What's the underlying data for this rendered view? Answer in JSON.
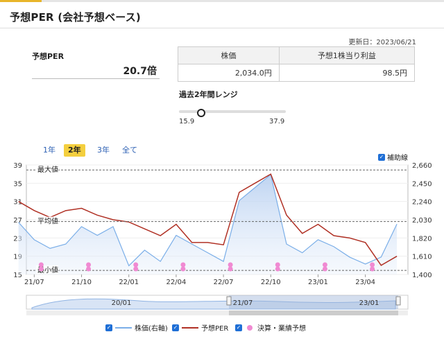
{
  "header": {
    "title": "予想PER (会社予想ベース)"
  },
  "updated": "更新日：2023/06/21",
  "per": {
    "label": "予想PER",
    "value": "20.7倍"
  },
  "stock_table": {
    "headers": [
      "株価",
      "予想1株当り利益"
    ],
    "values": [
      "2,034.0円",
      "98.5円"
    ]
  },
  "range": {
    "label": "過去2年間レンジ",
    "min": "15.9",
    "max": "37.9",
    "current": 20.7
  },
  "period_tabs": [
    {
      "label": "1年",
      "active": false
    },
    {
      "label": "2年",
      "active": true
    },
    {
      "label": "3年",
      "active": false
    },
    {
      "label": "全て",
      "active": false
    }
  ],
  "aux_line": {
    "label": "補助線",
    "checked": true
  },
  "chart_data": {
    "type": "line",
    "left_axis_ticks": [
      "39",
      "35",
      "31",
      "27",
      "23",
      "19",
      "15"
    ],
    "right_axis_ticks": [
      "2,660",
      "2,450",
      "2,240",
      "2,030",
      "1,820",
      "1,610",
      "1,400"
    ],
    "x_ticks": [
      "21/07",
      "21/10",
      "22/01",
      "22/04",
      "22/07",
      "22/10",
      "23/01",
      "23/04"
    ],
    "reference_lines": [
      {
        "label": "最大値",
        "value": 37.9
      },
      {
        "label": "平均値",
        "value": 26.6
      },
      {
        "label": "最小値",
        "value": 15.9
      }
    ],
    "series": [
      {
        "name": "予想PER",
        "axis": "left",
        "color": "#b03024",
        "x": [
          "21/06",
          "21/07",
          "21/08",
          "21/09",
          "21/10",
          "21/11",
          "21/12",
          "22/01",
          "22/02",
          "22/03",
          "22/04",
          "22/05",
          "22/06",
          "22/07",
          "22/08",
          "22/09",
          "22/10",
          "22/11",
          "22/12",
          "23/01",
          "23/02",
          "23/03",
          "23/04",
          "23/05",
          "23/06"
        ],
        "values": [
          31,
          29,
          27.5,
          29,
          29.5,
          28,
          27,
          26.5,
          25,
          23.5,
          26,
          22,
          22,
          21.5,
          33,
          35,
          37,
          28,
          24,
          26,
          23.5,
          23,
          22,
          17,
          19
        ]
      },
      {
        "name": "株価(右軸)",
        "axis": "right",
        "color": "#7aaee8",
        "x": [
          "21/06",
          "21/07",
          "21/08",
          "21/09",
          "21/10",
          "21/11",
          "21/12",
          "22/01",
          "22/02",
          "22/03",
          "22/04",
          "22/05",
          "22/06",
          "22/07",
          "22/08",
          "22/09",
          "22/10",
          "22/11",
          "22/12",
          "23/01",
          "23/02",
          "23/03",
          "23/04",
          "23/05",
          "23/06"
        ],
        "values": [
          2000,
          1800,
          1700,
          1750,
          1950,
          1850,
          1950,
          1500,
          1680,
          1550,
          1850,
          1750,
          1650,
          1550,
          2250,
          2400,
          2550,
          1750,
          1650,
          1800,
          1720,
          1600,
          1520,
          1600,
          1980
        ]
      }
    ],
    "events": {
      "name": "決算・業績予想",
      "x": [
        "21/07",
        "21/10",
        "22/01",
        "22/04",
        "22/07",
        "22/10",
        "23/01",
        "23/04"
      ]
    },
    "navigator_labels": [
      "20/01",
      "21/07",
      "23/01"
    ]
  },
  "legend": [
    {
      "label": "株価(右軸)",
      "color": "#7aaee8"
    },
    {
      "label": "予想PER",
      "color": "#b03024"
    },
    {
      "label": "決算・業績予想",
      "color": "#f08ad2"
    }
  ]
}
